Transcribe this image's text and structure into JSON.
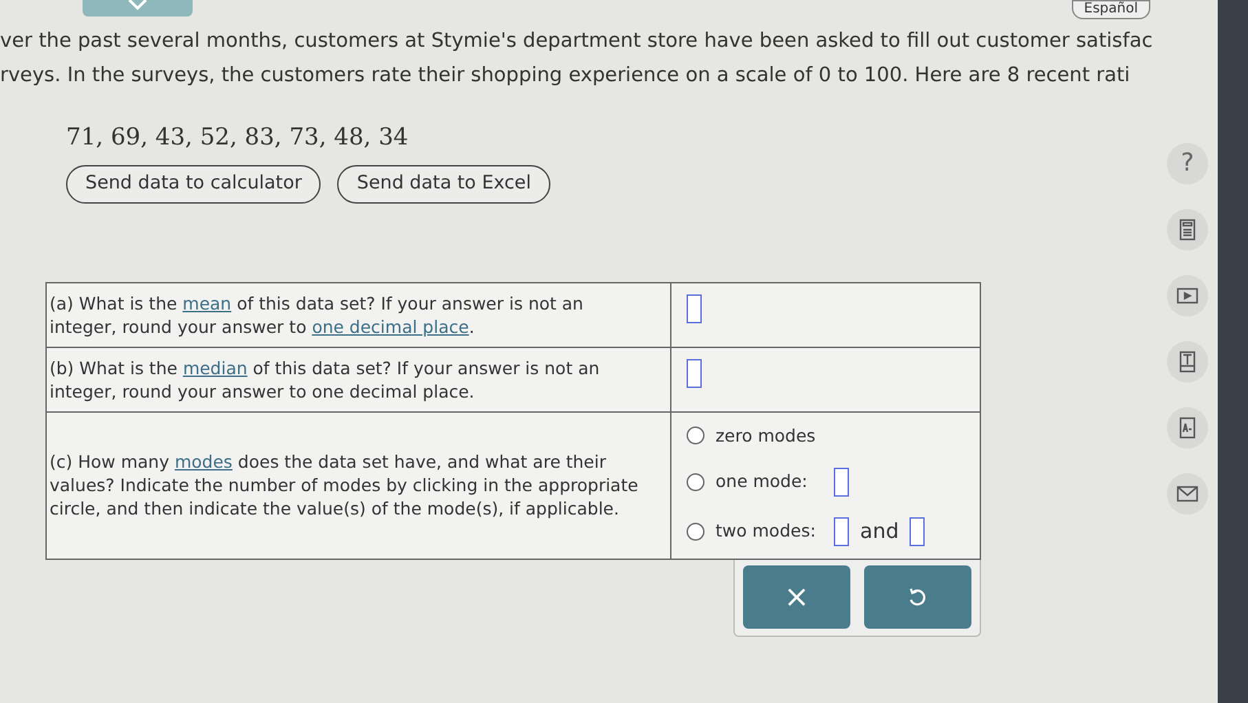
{
  "language_button": "Español",
  "problem_lines": [
    "ver the past several months, customers at Stymie's department store have been asked to fill out customer satisfac",
    "rveys. In the surveys, the customers rate their shopping experience on a scale of 0 to 100. Here are 8 recent rati"
  ],
  "data_values": "71, 69, 43, 52, 83, 73, 48, 34",
  "data_buttons": [
    "Send data to calculator",
    "Send data to Excel"
  ],
  "help": "?",
  "questions": [
    {
      "kind": "input",
      "parts": [
        {
          "t": "(a) What is the ",
          "kind": "text"
        },
        {
          "t": "mean",
          "kind": "link"
        },
        {
          "t": " of this data set? If your answer is not an integer, round your answer to ",
          "kind": "text"
        },
        {
          "t": "one decimal place",
          "kind": "link"
        },
        {
          "t": ".",
          "kind": "text"
        }
      ]
    },
    {
      "kind": "input",
      "parts": [
        {
          "t": "(b) What is the ",
          "kind": "text"
        },
        {
          "t": "median",
          "kind": "link"
        },
        {
          "t": " of this data set? If your answer is not an integer, round your answer to one decimal place.",
          "kind": "text"
        }
      ]
    },
    {
      "kind": "modes",
      "parts": [
        {
          "t": "(c) How many ",
          "kind": "text"
        },
        {
          "t": "modes",
          "kind": "link"
        },
        {
          "t": " does the data set have, and what are their values? Indicate the number of modes by clicking in the appropriate circle, and then indicate the value(s) of the mode(s), if applicable.",
          "kind": "text"
        }
      ],
      "options": [
        {
          "label": "zero modes",
          "kind": "plain",
          "selected": false
        },
        {
          "label": "one mode:",
          "kind": "one",
          "selected": false
        },
        {
          "label": "two modes:",
          "kind": "two",
          "selected": false,
          "joiner": "and"
        }
      ]
    }
  ],
  "action_buttons": [
    "×"
  ]
}
